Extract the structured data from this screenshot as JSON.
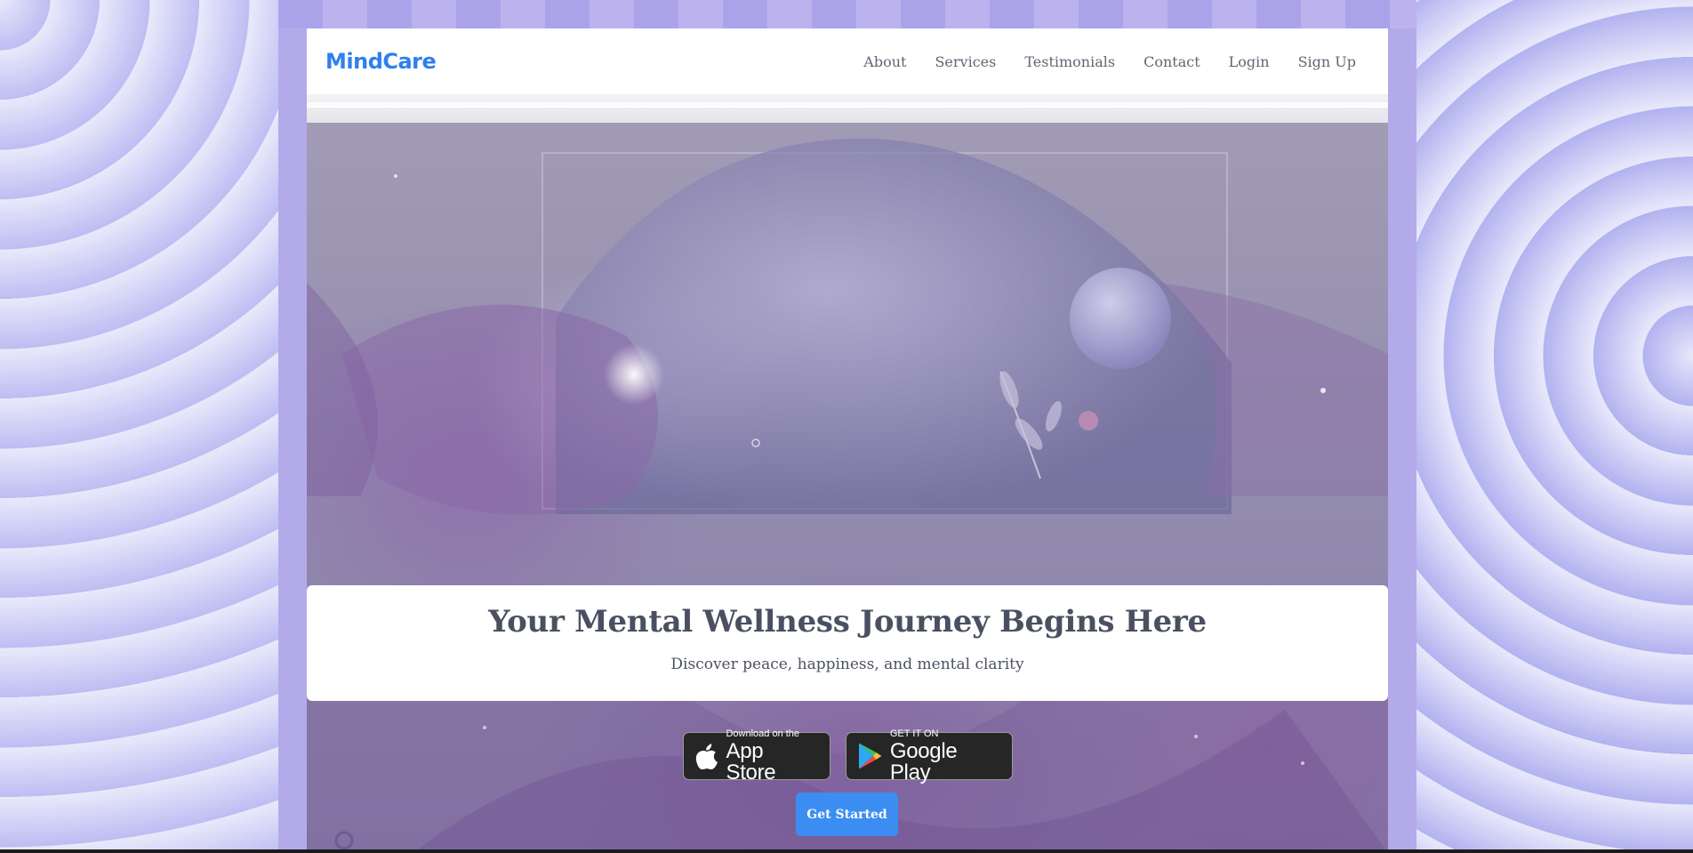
{
  "nav": {
    "brand": "MindCare",
    "links": [
      "About",
      "Services",
      "Testimonials",
      "Contact",
      "Login",
      "Sign Up"
    ]
  },
  "hero": {
    "title": "Your Mental Wellness Journey Begins Here",
    "subtitle": "Discover peace, happiness, and mental clarity",
    "app_store": {
      "small": "Download on the",
      "big": "App Store"
    },
    "google_play": {
      "small": "GET IT ON",
      "big": "Google Play"
    },
    "cta": "Get Started"
  },
  "colors": {
    "brand": "#2f80ed",
    "cta": "#3b8df2",
    "text": "#4a5061"
  }
}
